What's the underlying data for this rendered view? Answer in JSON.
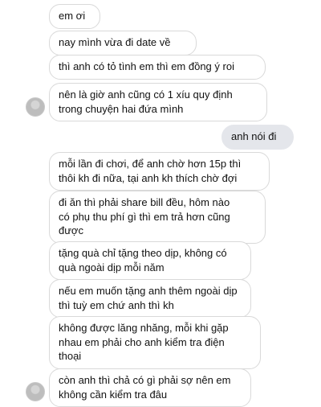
{
  "messages": [
    {
      "sender": "them",
      "text": "em ơi"
    },
    {
      "sender": "them",
      "text": "nay mình vừa đi date về"
    },
    {
      "sender": "them",
      "text": "thì anh có tỏ tình em thì em đồng ý roi"
    },
    {
      "sender": "them",
      "text": "nên là giờ anh cũng có 1 xíu quy định\ntrong chuyện hai đứa mình"
    },
    {
      "sender": "me",
      "text": "anh nói đi"
    },
    {
      "sender": "them",
      "text": "mỗi lần đi chơi, để anh chờ hơn 15p thì\nthôi kh đi nữa, tại anh kh thích chờ đợi"
    },
    {
      "sender": "them",
      "text": "đi ăn thì phải share bill đều, hôm nào\ncó phụ thu phí gì thì em trả hơn cũng\nđược"
    },
    {
      "sender": "them",
      "text": "tặng quà chỉ tặng theo dịp, không có\nquà ngoài dịp mỗi năm"
    },
    {
      "sender": "them",
      "text": "nếu em muốn tặng anh thêm ngoài dịp\nthì tuỳ em chứ anh thì kh"
    },
    {
      "sender": "them",
      "text": "không được lăng nhăng, mỗi khi gặp\nnhau em phải cho anh kiểm tra điện\nthoại"
    },
    {
      "sender": "them",
      "text": "còn anh thì chả có gì phải sợ nên em\nkhông cần kiểm tra đâu"
    }
  ],
  "colors": {
    "incoming_bubble": "#ffffff",
    "incoming_border": "#d9d9d9",
    "outgoing_bubble": "#e4e6eb",
    "text": "#111111"
  }
}
